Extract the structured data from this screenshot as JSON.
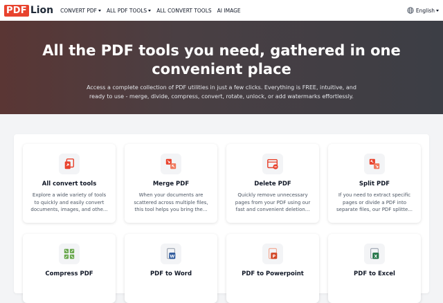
{
  "nav": {
    "logo_pdf": "PDF",
    "logo_lion": "Lion",
    "links": [
      "CONVERT PDF",
      "ALL PDF TOOLS",
      "ALL CONVERT TOOLS",
      "AI IMAGE"
    ],
    "language": "English"
  },
  "hero": {
    "title": "All the PDF tools you need, gathered in one convenient place",
    "subtitle": "Access a complete collection of PDF utilities in just a few clicks. Everything is FREE, intuitive, and ready to use - merge, divide, compress, convert, rotate, unlock, or add watermarks effortlessly."
  },
  "tools": [
    {
      "title": "All convert tools",
      "desc": "Explore a wide variety of tools to quickly and easily convert documents, images, and othe...",
      "icon": "convert-icon"
    },
    {
      "title": "Merge PDF",
      "desc": "When your documents are scattered across multiple files, this tool helps you bring the...",
      "icon": "merge-icon"
    },
    {
      "title": "Delete PDF",
      "desc": "Quickly remove unnecessary pages from your PDF using our fast and convenient deletion...",
      "icon": "delete-icon"
    },
    {
      "title": "Split PDF",
      "desc": "If you need to extract specific pages or divide a PDF into separate files, our PDF splitte...",
      "icon": "split-icon"
    },
    {
      "title": "Compress PDF",
      "desc": "",
      "icon": "compress-icon"
    },
    {
      "title": "PDF to Word",
      "desc": "",
      "icon": "word-icon"
    },
    {
      "title": "PDF to Powerpoint",
      "desc": "",
      "icon": "powerpoint-icon"
    },
    {
      "title": "PDF to Excel",
      "desc": "",
      "icon": "excel-icon"
    }
  ],
  "colors": {
    "brand": "#e8432e",
    "word": "#2b579a",
    "powerpoint": "#d24726",
    "excel": "#217346",
    "compress": "#6aa84f"
  }
}
